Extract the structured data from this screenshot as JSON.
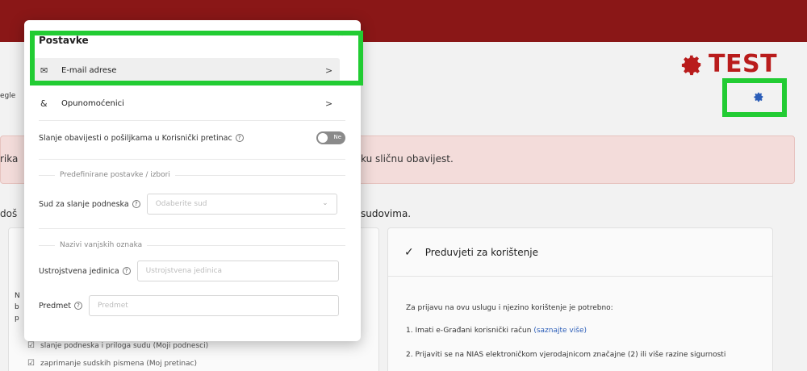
{
  "brand": {
    "title": "TEST",
    "color": "#b91c1c",
    "icon": "gear-icon"
  },
  "header": {
    "settings_icon": "gear-icon",
    "topbar_color": "#8a1717"
  },
  "background": {
    "left_fragment_1": "egle",
    "left_fragment_2": "rika",
    "left_fragment_3": "doš",
    "alert_text": "ku sličnu obavijest.",
    "tail_text": "sudovima.",
    "left_card_lines": [
      "N",
      "b",
      "p"
    ],
    "left_card_items": [
      "slanje podneska i priloga sudu (Moji podnesci)",
      "zaprimanje sudskih pismena (Moj pretinac)"
    ],
    "card": {
      "title": "Preduvjeti za korištenje",
      "intro": "Za prijavu na ovu uslugu i njezino korištenje je potrebno:",
      "item1_text": "1. Imati e-Građani korisnički račun",
      "item1_link": "(saznajte više)",
      "item2_text": "2. Prijaviti se na NIAS elektroničkom vjerodajnicom značajne (2) ili više razine sigurnosti"
    }
  },
  "modal": {
    "title": "Postavke",
    "close_icon": "chevron-up-icon",
    "menu": [
      {
        "icon": "mail-icon",
        "label": "E-mail adrese",
        "arrow": ">"
      },
      {
        "icon": "users-icon",
        "label": "Opunomoćenici",
        "arrow": ">"
      }
    ],
    "notify_label": "Slanje obavijesti o pošiljkama u Korisnički pretinac",
    "notify_toggle": "Ne",
    "section_predefined": "Predefinirane postavke / izbori",
    "court_label": "Sud za slanje podneska",
    "court_placeholder": "Odaberite sud",
    "section_external": "Nazivi vanjskih oznaka",
    "unit_label": "Ustrojstvena jedinica",
    "unit_placeholder": "Ustrojstvena jedinica",
    "subject_label": "Predmet",
    "subject_placeholder": "Predmet",
    "help_glyph": "?"
  },
  "highlight_color": "#22cc33"
}
